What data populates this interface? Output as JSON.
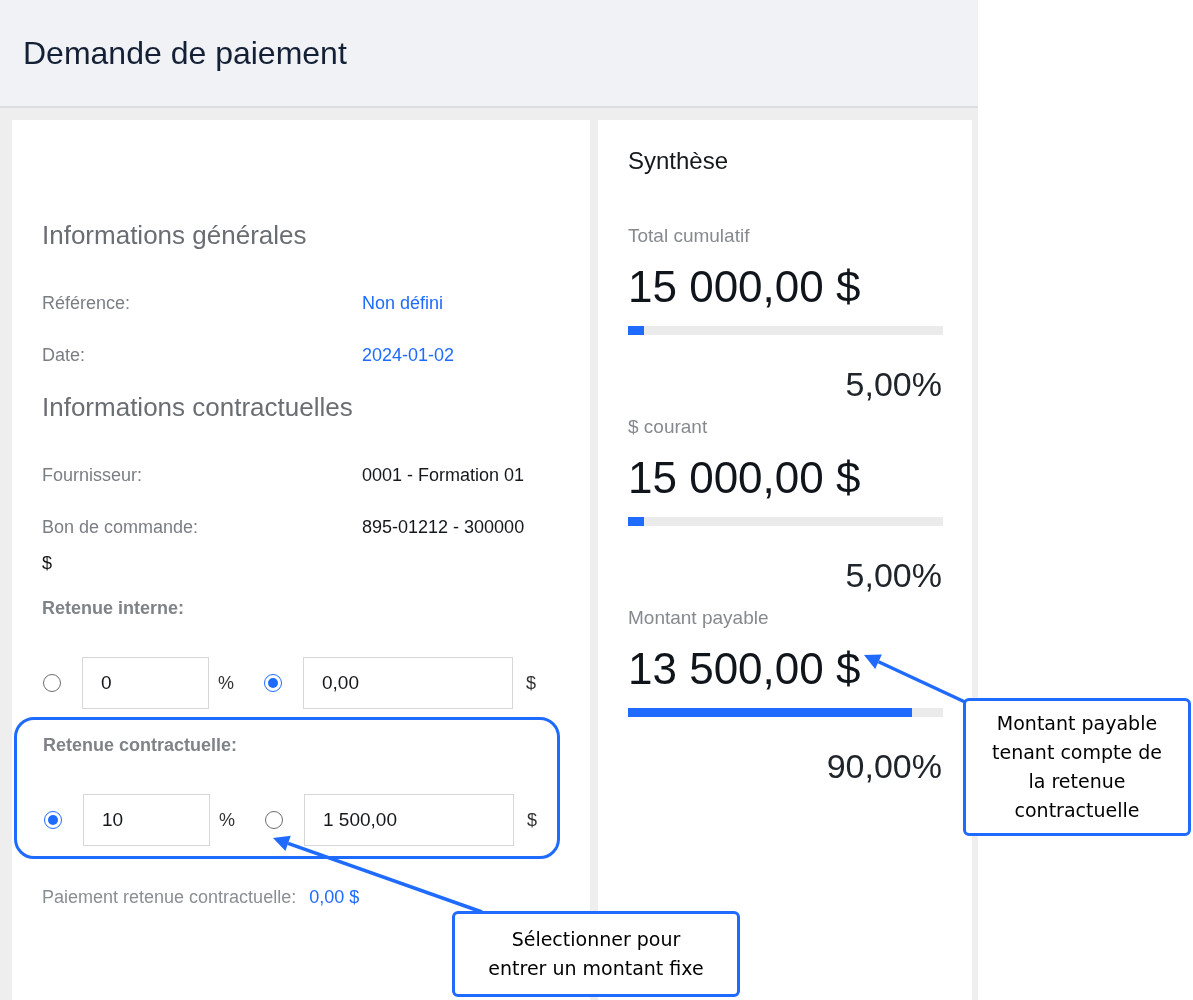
{
  "page_title": "Demande de paiement",
  "general": {
    "heading": "Informations générales",
    "fields": [
      {
        "label": "Référence:",
        "value": "Non défini",
        "kind": "link"
      },
      {
        "label": "Date:",
        "value": "2024-01-02",
        "kind": "link"
      }
    ]
  },
  "contract": {
    "heading": "Informations contractuelles",
    "fields": [
      {
        "label": "Fournisseur:",
        "value": "0001 - Formation 01",
        "kind": "text"
      },
      {
        "label": "Bon de commande:",
        "value": "895-01212 - 300000",
        "unit": "$",
        "kind": "text"
      }
    ]
  },
  "retentions": [
    {
      "title": "Retenue interne:",
      "highlighted": false,
      "percent": {
        "selected": false,
        "value": "0",
        "unit": "%"
      },
      "amount": {
        "selected": true,
        "value": "0,00",
        "unit": "$"
      }
    },
    {
      "title": "Retenue contractuelle:",
      "highlighted": true,
      "percent": {
        "selected": true,
        "value": "10",
        "unit": "%"
      },
      "amount": {
        "selected": false,
        "value": "1 500,00",
        "unit": "$"
      }
    }
  ],
  "payment": {
    "label": "Paiement retenue contractuelle:",
    "value": "0,00 $"
  },
  "summary": {
    "title": "Synthèse",
    "items": [
      {
        "label": "Total cumulatif",
        "amount": "15 000,00 $",
        "level": 0.05,
        "percent": "5,00%"
      },
      {
        "label": "$ courant",
        "amount": "15 000,00 $",
        "level": 0.05,
        "percent": "5,00%"
      },
      {
        "label": "Montant payable",
        "amount": "13 500,00 $",
        "level": 0.9,
        "percent": "90,00%"
      }
    ]
  },
  "callouts": [
    {
      "text": "Montant payable tenant compte de la retenue contractuelle"
    },
    {
      "text": "Sélectionner pour entrer un montant fixe"
    }
  ]
}
